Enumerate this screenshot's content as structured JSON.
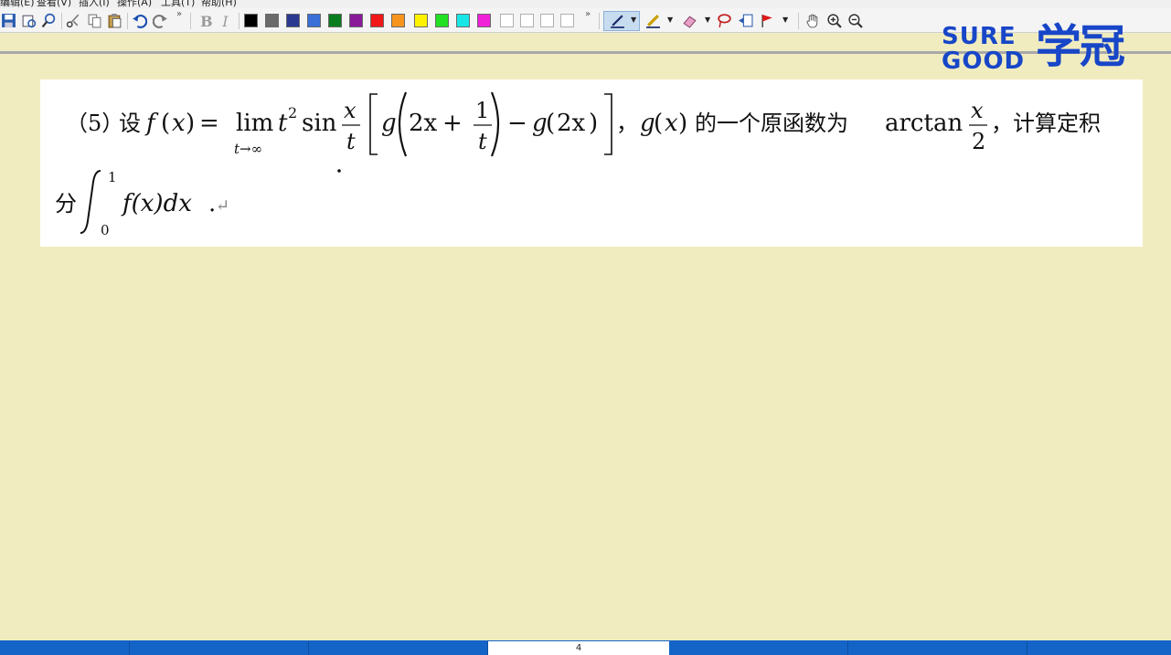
{
  "menu": {
    "items": [
      "编辑(E)",
      "查看(V)",
      "插入(I)",
      "操作(A)",
      "工具(T)",
      "帮助(H)"
    ]
  },
  "toolbar": {
    "overflow_glyph": "»",
    "colors": [
      "#000000",
      "#6a6a6a",
      "#2b3990",
      "#3a6fd8",
      "#0a7d1e",
      "#8a1a9a",
      "#f01818",
      "#f7941d",
      "#fff200",
      "#22e022",
      "#19e6e6",
      "#f020d8"
    ],
    "empty_swatches": 4
  },
  "logo": {
    "line1": "SURE",
    "line2": "GOOD",
    "chinese": "学冠",
    "color": "#1846c8"
  },
  "problem": {
    "number": "（5）",
    "she": "设",
    "f_of_x": "f",
    "x": "x",
    "eq": "=",
    "lim": "lim",
    "lim_sub": "t→∞",
    "t": "t",
    "sup2": "2",
    "sin": "sin",
    "frac_num": "x",
    "frac_den": "t",
    "g": "g",
    "two_x": "2x",
    "plus": "+",
    "one": "1",
    "minus": "−",
    "comma1": "，",
    "text_mid": "的一个原函数为",
    "arctan": "arctan",
    "frac2_num": "x",
    "frac2_den": "2",
    "text_end": "，计算定积",
    "line2_prefix": "分",
    "int_upper": "1",
    "int_lower": "0",
    "integrand": "f(x)dx",
    "period": ".",
    "return_mark": "↵"
  },
  "statusbar": {
    "page": "4"
  }
}
